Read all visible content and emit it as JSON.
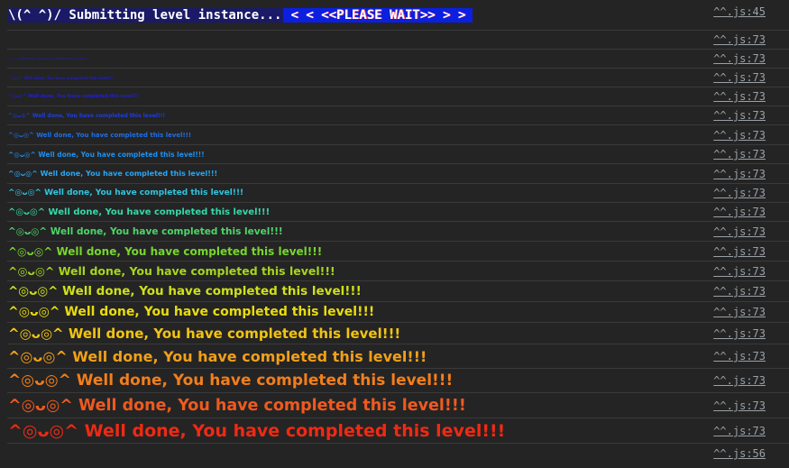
{
  "first_row": {
    "part1": "\\(^ ^)/ Submitting level instance...",
    "part2": "<  < <<PLEASE WAIT>> >  >",
    "source": "^^.js:45"
  },
  "rows": [
    {
      "text": "",
      "source": "^^.js:73",
      "color": "#2020c8"
    },
    {
      "text": "^◎ᴗ◎^ Well done, You have completed this level!!!",
      "source": "^^.js:73",
      "color": "#1f1fb0"
    },
    {
      "text": "^◎ᴗ◎^ Well done, You have completed this level!!!",
      "source": "^^.js:73",
      "color": "#1f1fc0"
    },
    {
      "text": "^◎ᴗ◎^ Well done, You have completed this level!!!",
      "source": "^^.js:73",
      "color": "#2020d0"
    },
    {
      "text": "^◎ᴗ◎^ Well done, You have completed this level!!!",
      "source": "^^.js:73",
      "color": "#1f3ce0"
    },
    {
      "text": "^◎ᴗ◎^ Well done, You have completed this level!!!",
      "source": "^^.js:73",
      "color": "#1f6ee6"
    },
    {
      "text": "^◎ᴗ◎^ Well done, You have completed this level!!!",
      "source": "^^.js:73",
      "color": "#1e90ef"
    },
    {
      "text": "^◎ᴗ◎^ Well done, You have completed this level!!!",
      "source": "^^.js:73",
      "color": "#29a6f2"
    },
    {
      "text": "^◎ᴗ◎^ Well done, You have completed this level!!!",
      "source": "^^.js:73",
      "color": "#2ec6e0"
    },
    {
      "text": "^◎ᴗ◎^ Well done, You have completed this level!!!",
      "source": "^^.js:73",
      "color": "#35d9a8"
    },
    {
      "text": "^◎ᴗ◎^ Well done, You have completed this level!!!",
      "source": "^^.js:73",
      "color": "#4cd66a"
    },
    {
      "text": "^◎ᴗ◎^ Well done, You have completed this level!!!",
      "source": "^^.js:73",
      "color": "#77d62e"
    },
    {
      "text": "^◎ᴗ◎^ Well done, You have completed this level!!!",
      "source": "^^.js:73",
      "color": "#a6d61e"
    },
    {
      "text": "^◎ᴗ◎^ Well done, You have completed this level!!!",
      "source": "^^.js:73",
      "color": "#cfe01a"
    },
    {
      "text": "^◎ᴗ◎^ Well done, You have completed this level!!!",
      "source": "^^.js:73",
      "color": "#e8dc10"
    },
    {
      "text": "^◎ᴗ◎^ Well done, You have completed this level!!!",
      "source": "^^.js:73",
      "color": "#f2c412"
    },
    {
      "text": "^◎ᴗ◎^ Well done, You have completed this level!!!",
      "source": "^^.js:73",
      "color": "#f2a018"
    },
    {
      "text": "^◎ᴗ◎^ Well done, You have completed this level!!!",
      "source": "^^.js:73",
      "color": "#f27e1c"
    },
    {
      "text": "^◎ᴗ◎^ Well done, You have completed this level!!!",
      "source": "^^.js:73",
      "color": "#f05a1e"
    },
    {
      "text": "^◎ᴗ◎^ Well done, You have completed this level!!!",
      "source": "^^.js:73",
      "color": "#ee2a14"
    }
  ],
  "last_row": {
    "source": "^^.js:56"
  }
}
